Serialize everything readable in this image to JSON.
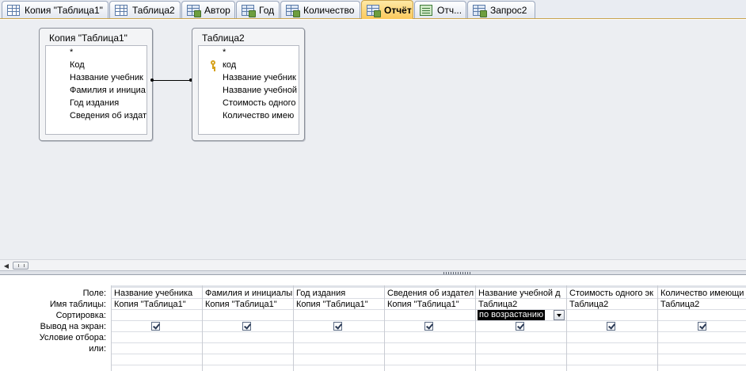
{
  "tabs": [
    {
      "label": "Копия \"Таблица1\"",
      "icon": "table-icon",
      "active": false
    },
    {
      "label": "Таблица2",
      "icon": "table-icon",
      "active": false
    },
    {
      "label": "Автор",
      "icon": "query-icon",
      "active": false
    },
    {
      "label": "Год",
      "icon": "query-icon",
      "active": false
    },
    {
      "label": "Количество",
      "icon": "query-icon",
      "active": false
    },
    {
      "label": "Отчёт",
      "icon": "query-icon",
      "active": true
    },
    {
      "label": "Отч...",
      "icon": "report-icon",
      "active": false
    },
    {
      "label": "Запрос2",
      "icon": "query-icon",
      "active": false
    }
  ],
  "tables": [
    {
      "title": "Копия \"Таблица1\"",
      "fields": [
        {
          "label": "*",
          "key": false
        },
        {
          "label": "Код",
          "key": false
        },
        {
          "label": "Название учебник",
          "key": false
        },
        {
          "label": "Фамилия и инициа",
          "key": false
        },
        {
          "label": "Год издания",
          "key": false
        },
        {
          "label": "Сведения об издат",
          "key": false
        }
      ]
    },
    {
      "title": "Таблица2",
      "fields": [
        {
          "label": "*",
          "key": false
        },
        {
          "label": "код",
          "key": true
        },
        {
          "label": "Название учебник",
          "key": false
        },
        {
          "label": "Название учебной",
          "key": false
        },
        {
          "label": "Стоимость одного",
          "key": false
        },
        {
          "label": "Количество имею",
          "key": false
        }
      ]
    }
  ],
  "grid": {
    "row_labels": {
      "field": "Поле:",
      "table": "Имя таблицы:",
      "sort": "Сортировка:",
      "show": "Вывод на экран:",
      "criteria": "Условие отбора:",
      "or": "или:"
    },
    "columns": [
      {
        "field": "Название учебника",
        "table": "Копия \"Таблица1\"",
        "sort": "",
        "show": true
      },
      {
        "field": "Фамилия и инициалы",
        "table": "Копия \"Таблица1\"",
        "sort": "",
        "show": true
      },
      {
        "field": "Год издания",
        "table": "Копия \"Таблица1\"",
        "sort": "",
        "show": true
      },
      {
        "field": "Сведения об издател",
        "table": "Копия \"Таблица1\"",
        "sort": "",
        "show": true
      },
      {
        "field": "Название учебной д",
        "table": "Таблица2",
        "sort": "по возрастанию",
        "show": true
      },
      {
        "field": "Стоимость одного эк",
        "table": "Таблица2",
        "sort": "",
        "show": true
      },
      {
        "field": "Количество имеющи",
        "table": "Таблица2",
        "sort": "",
        "show": true
      }
    ]
  },
  "colors": {
    "active_tab": "#fbc95b",
    "pane_background": "#eceef2"
  }
}
